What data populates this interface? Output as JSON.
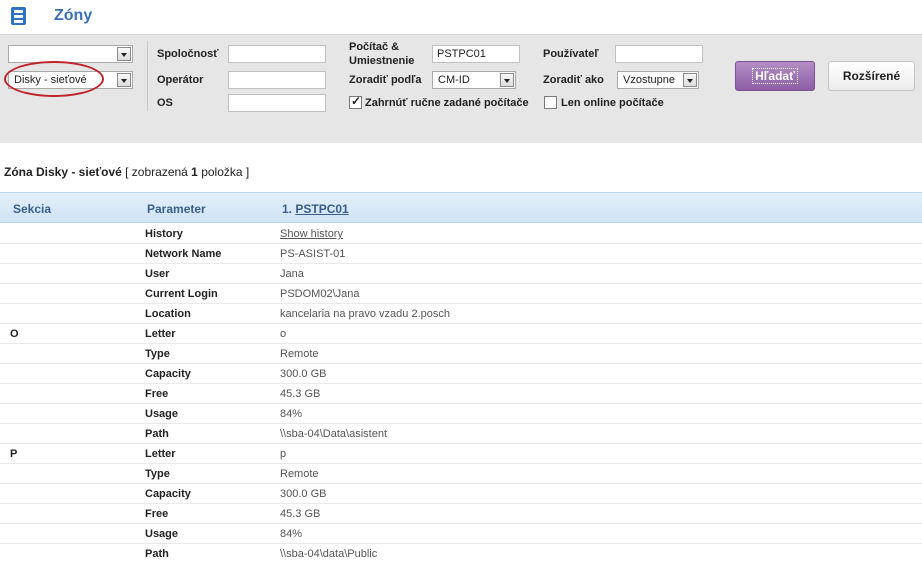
{
  "header": {
    "title": "Zóny",
    "icon": "app-logo-icon"
  },
  "filters": {
    "zone_select_top": "",
    "zone_select": "Disky - sieťové",
    "spolocnost_label": "Spoločnosť",
    "spolocnost_value": "",
    "operator_label": "Operátor",
    "operator_value": "",
    "os_label": "OS",
    "os_value": "",
    "pocitac_label": "Počítač &",
    "umiestnenie_label": "Umiestnenie",
    "pocitac_value": "PSTPC01",
    "zoradit_podla_label": "Zoradiť podľa",
    "zoradit_podla_value": "CM-ID",
    "pouzivatel_label": "Používateľ",
    "pouzivatel_value": "",
    "zoradit_ako_label": "Zoradiť ako",
    "zoradit_ako_value": "Vzostupne",
    "manual_label": "Zahrnúť ručne zadané počítače",
    "online_label": "Len online počítače",
    "search_button": "Hľadať",
    "advanced_button": "Rozšírené"
  },
  "zone": {
    "prefix": "Zóna Disky - sieťové",
    "shown_open": " [ zobrazená ",
    "count": "1",
    "shown_close": " položka ]"
  },
  "table": {
    "col_section": "Sekcia",
    "col_parameter": "Parameter",
    "col_pc_number": "1.",
    "col_pc_name": "PSTPC01",
    "rows": [
      {
        "section": "",
        "param": "History",
        "value": "Show history",
        "link": true
      },
      {
        "section": "",
        "param": "Network Name",
        "value": "PS-ASIST-01"
      },
      {
        "section": "",
        "param": "User",
        "value": "Jana"
      },
      {
        "section": "",
        "param": "Current Login",
        "value": "PSDOM02\\Jana"
      },
      {
        "section": "",
        "param": "Location",
        "value": "kancelaria na pravo vzadu 2.posch"
      },
      {
        "section": "O",
        "param": "Letter",
        "value": "o"
      },
      {
        "section": "",
        "param": "Type",
        "value": "Remote"
      },
      {
        "section": "",
        "param": "Capacity",
        "value": "300.0 GB"
      },
      {
        "section": "",
        "param": "Free",
        "value": "45.3 GB"
      },
      {
        "section": "",
        "param": "Usage",
        "value": "84%"
      },
      {
        "section": "",
        "param": "Path",
        "value": "\\\\sba-04\\Data\\asistent"
      },
      {
        "section": "P",
        "param": "Letter",
        "value": "p"
      },
      {
        "section": "",
        "param": "Type",
        "value": "Remote"
      },
      {
        "section": "",
        "param": "Capacity",
        "value": "300.0 GB"
      },
      {
        "section": "",
        "param": "Free",
        "value": "45.3 GB"
      },
      {
        "section": "",
        "param": "Usage",
        "value": "84%"
      },
      {
        "section": "",
        "param": "Path",
        "value": "\\\\sba-04\\data\\Public"
      }
    ]
  }
}
